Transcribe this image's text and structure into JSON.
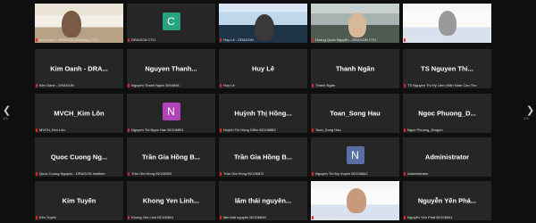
{
  "navigation": {
    "prev_icon": "chevron-left-icon",
    "next_icon": "chevron-right-icon",
    "prev_page": "1/3",
    "next_page": "1/3"
  },
  "tiles": [
    {
      "kind": "video",
      "caption": "Kim Oanh - DRAGON (Mekong_CTU"
    },
    {
      "kind": "avatar",
      "letter": "C",
      "color": "#29a37d",
      "caption": "DRAGON CTU"
    },
    {
      "kind": "video",
      "caption": "Huy Lê - DRAGON"
    },
    {
      "kind": "video",
      "caption": "Hoàng Quan Nguyễn - DRAGON CTU"
    },
    {
      "kind": "video",
      "caption": "Nguyen Thi Nhu Trang"
    },
    {
      "kind": "name",
      "name": "Kim Oanh - DRA...",
      "caption": "Kim Oanh - DRAGON"
    },
    {
      "kind": "name",
      "name": "Nguyen Thanh...",
      "caption": "Nguyen Thanh Ngan 3094848"
    },
    {
      "kind": "name",
      "name": "Huy Lê",
      "caption": "Huy Lê"
    },
    {
      "kind": "name",
      "name": "Thanh Ngân",
      "caption": "Thanh Ngân"
    },
    {
      "kind": "name",
      "name": "TS Nguyen Thi...",
      "caption": "TS Nguyen Thi Hy Lien (Viện Nam Can Tho"
    },
    {
      "kind": "name",
      "name": "MVCH_Kim Lôn",
      "caption": "MVCH_Kim Lôn"
    },
    {
      "kind": "avatar",
      "letter": "N",
      "color": "#b043b8",
      "caption": "Nguyen Thi Ngoc Han B2106891"
    },
    {
      "kind": "name",
      "name": "Huỳnh Thị Hồng...",
      "caption": "Huỳnh Thị Hồng Diễm B2106882"
    },
    {
      "kind": "name",
      "name": "Toan_Song Hau",
      "caption": "Toan_Song Hau"
    },
    {
      "kind": "name",
      "name": "Ngoc Phuong_D...",
      "caption": "Ngoc Phuong_Dragon"
    },
    {
      "kind": "name",
      "name": "Quoc Cuong Ng...",
      "caption": "Quoc Cuong Nguyen - DRAGON Institute"
    },
    {
      "kind": "name",
      "name": "Trần Gia Hồng B...",
      "caption": "Trần Gia Hồng B2106909"
    },
    {
      "kind": "name",
      "name": "Trần Gia Hồng B...",
      "caption": "Trần Gia Hồng B2106872"
    },
    {
      "kind": "avatar",
      "letter": "N",
      "color": "#5a6ea6",
      "caption": "Nguyen Thi My Xuyen B2106862"
    },
    {
      "kind": "name",
      "name": "Administrator",
      "caption": "Administrator"
    },
    {
      "kind": "name",
      "name": "Kim Tuyến",
      "caption": "Kim Tuyến"
    },
    {
      "kind": "name",
      "name": "Khong Yen Linh...",
      "caption": "Khong Yen Linh B2106841"
    },
    {
      "kind": "name",
      "name": "lâm thái nguyên...",
      "caption": "lâm thái nguyên B2106846"
    },
    {
      "kind": "video",
      "caption": "Ngoc Thu Bui (ko DRAGON)"
    },
    {
      "kind": "name",
      "name": "Nguyễn Yến Phá...",
      "caption": "Nguyễn Yến Phát B2106941"
    }
  ]
}
